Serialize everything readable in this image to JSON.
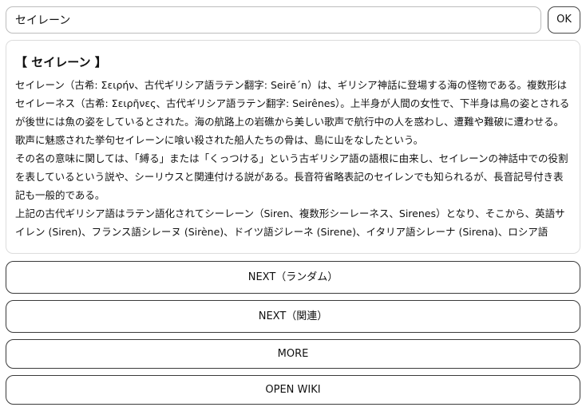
{
  "search": {
    "value": "セイレーン"
  },
  "ok_button": {
    "label": "OK"
  },
  "article": {
    "title": "【 セイレーン 】",
    "paragraphs": [
      "セイレーン（古希: Σειρήν、古代ギリシア語ラテン翻字: Seirē´n）は、ギリシア神話に登場する海の怪物である。複数形はセイレーネス（古希: Σειρῆνες、古代ギリシア語ラテン翻字: Seirênes）。上半身が人間の女性で、下半身は鳥の姿とされるが後世には魚の姿をしているとされた。海の航路上の岩礁から美しい歌声で航行中の人を惑わし、遭難や難破に遭わせる。歌声に魅惑された挙句セイレーンに喰い殺された船人たちの骨は、島に山をなしたという。",
      "その名の意味に関しては、「縛る」または「くっつける」という古ギリシア語の語根に由来し、セイレーンの神話中での役割を表しているという説や、シーリウスと関連付ける説がある。長音符省略表記のセイレンでも知られるが、長音記号付き表記も一般的である。",
      "上記の古代ギリシア語はラテン語化されてシーレーン（Siren、複数形シーレーネス、Sirenes）となり、そこから、英語サイレン (Siren)、フランス語シレーヌ (Sirène)、ドイツ語ジレーネ (Sirene)、イタリア語シレーナ (Sirena)、ロシア語"
    ]
  },
  "buttons": {
    "next_random": "NEXT（ランダム）",
    "next_related": "NEXT（関連）",
    "more": "MORE",
    "open_wiki": "OPEN WIKI"
  }
}
